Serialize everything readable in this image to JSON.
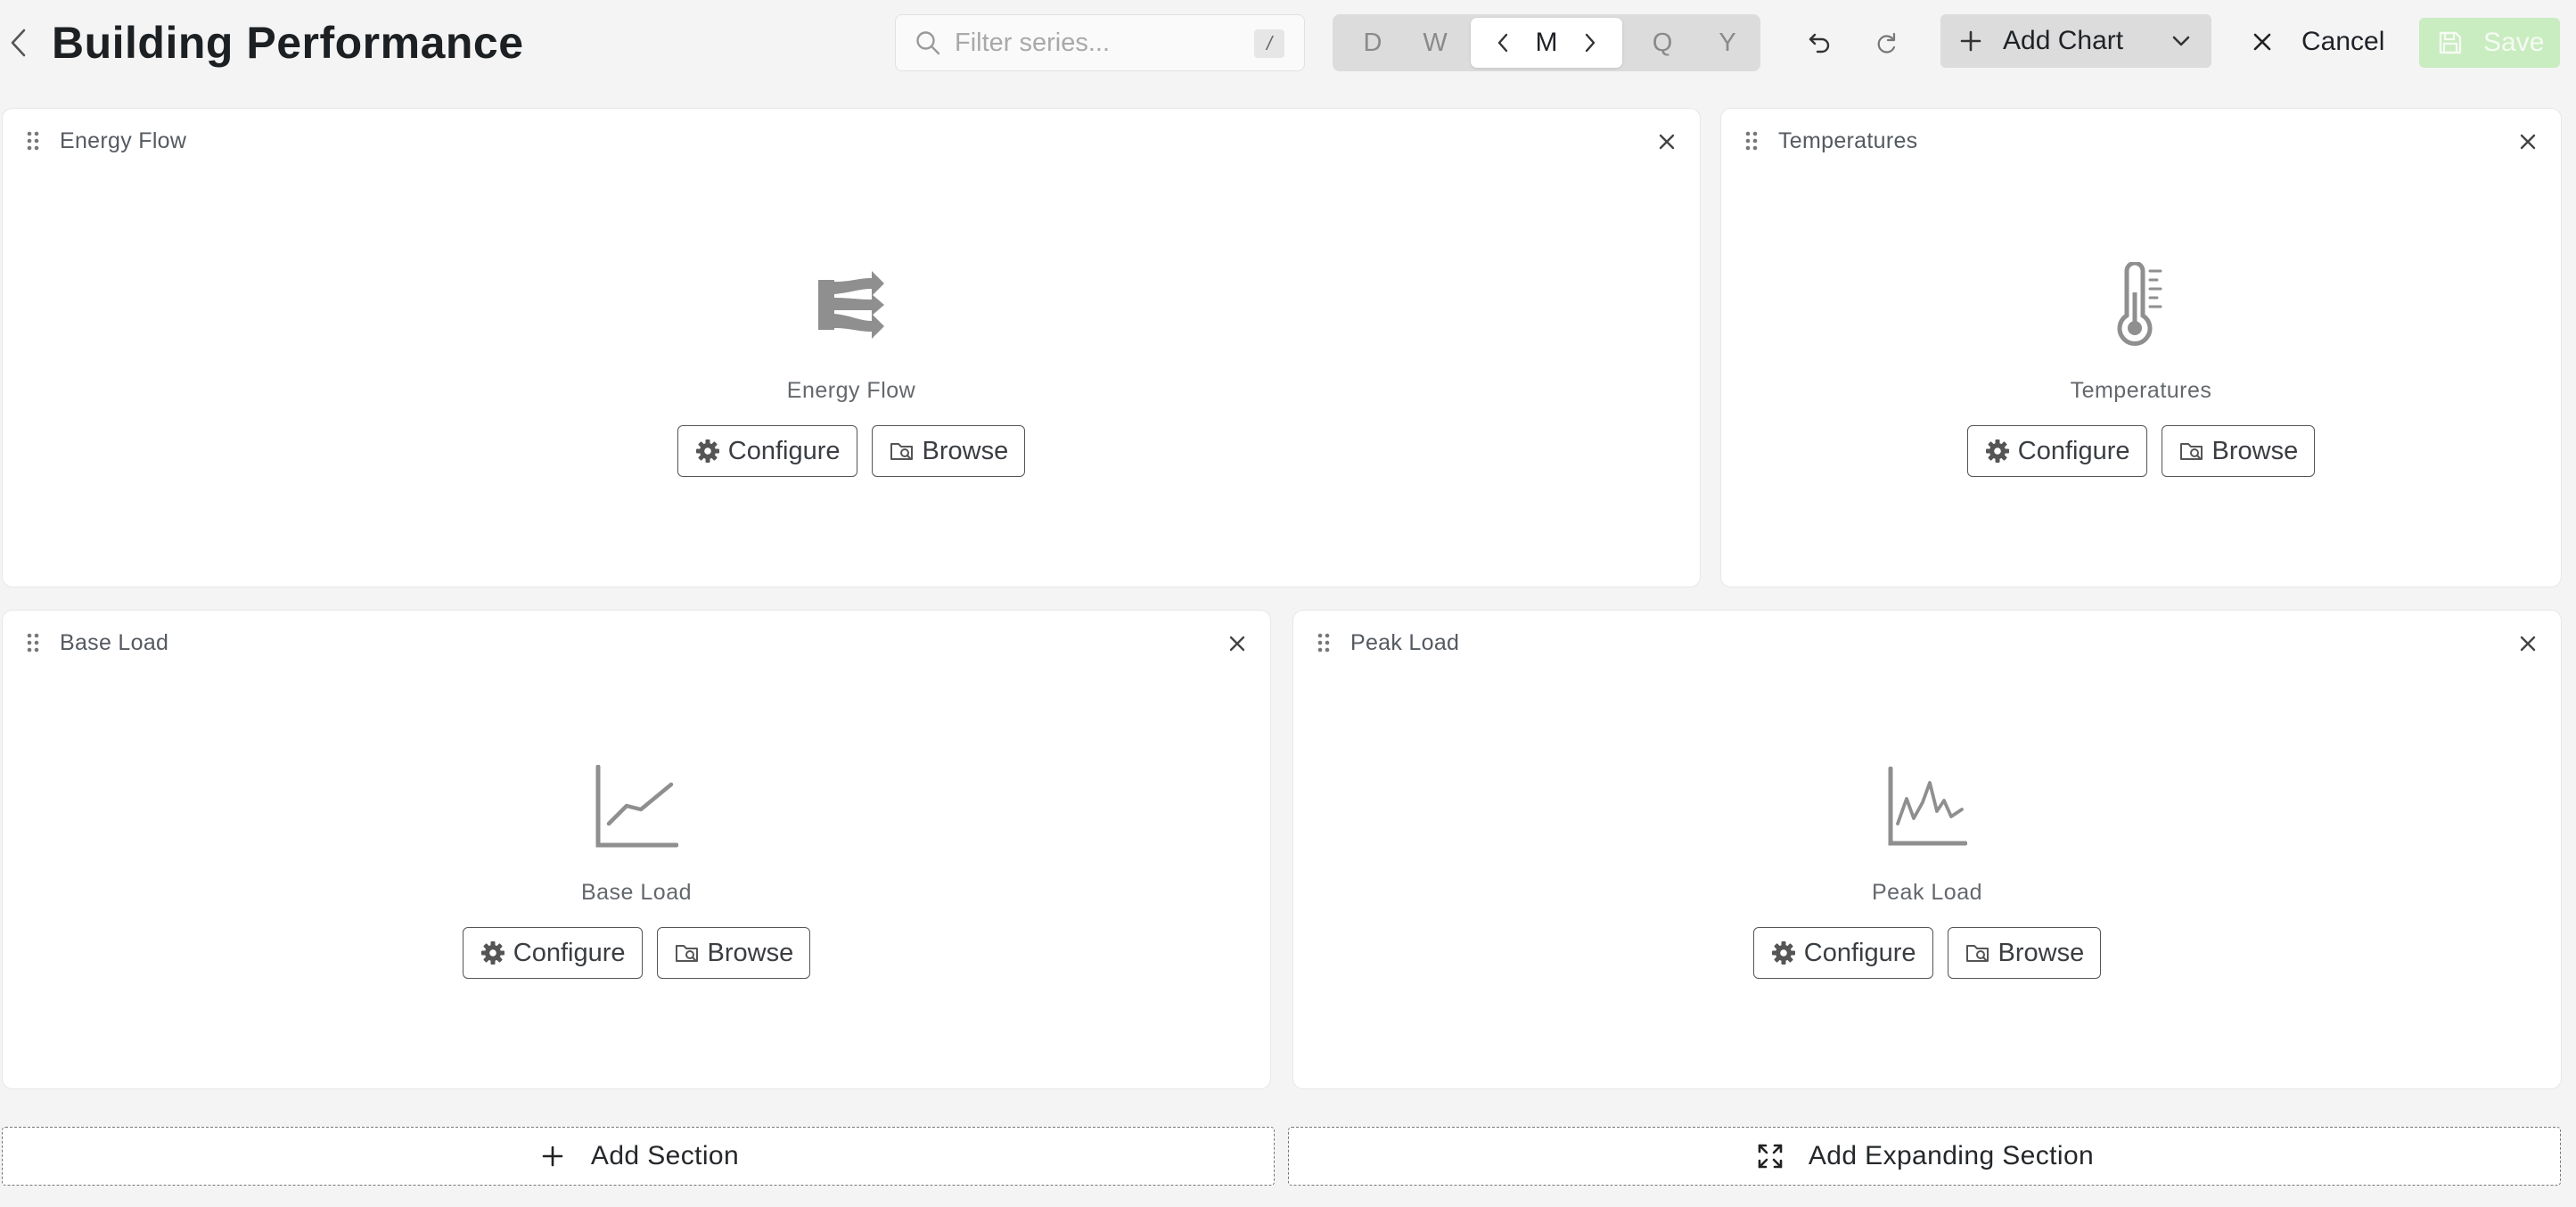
{
  "header": {
    "title": "Building Performance",
    "search_placeholder": "Filter series...",
    "search_shortcut": "/",
    "periods": [
      "D",
      "W",
      "M",
      "Q",
      "Y"
    ],
    "active_period": "M",
    "add_chart_label": "Add Chart",
    "cancel_label": "Cancel",
    "save_label": "Save"
  },
  "panels": [
    {
      "title": "Energy Flow",
      "placeholder_label": "Energy Flow",
      "icon": "sankey-icon"
    },
    {
      "title": "Temperatures",
      "placeholder_label": "Temperatures",
      "icon": "thermometer-icon"
    },
    {
      "title": "Base Load",
      "placeholder_label": "Base Load",
      "icon": "line-chart-icon"
    },
    {
      "title": "Peak Load",
      "placeholder_label": "Peak Load",
      "icon": "peak-chart-icon"
    }
  ],
  "panel_buttons": {
    "configure_label": "Configure",
    "browse_label": "Browse"
  },
  "footer": {
    "add_section_label": "Add Section",
    "add_expanding_section_label": "Add Expanding Section"
  },
  "colors": {
    "background": "#f4f4f4",
    "save_disabled": "#c9ecc0",
    "segment_bg": "#dcdcdc",
    "icon_gray": "#8f8f8f"
  }
}
